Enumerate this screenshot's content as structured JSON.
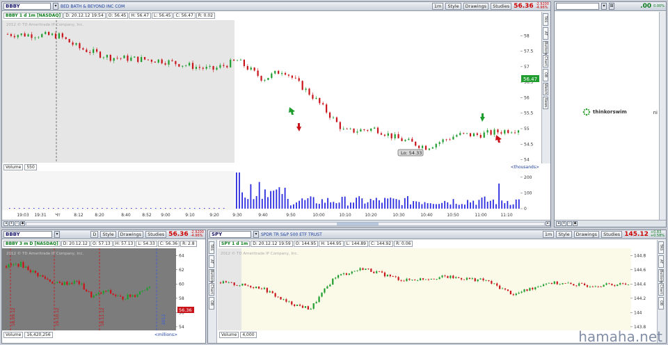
{
  "main": {
    "symbol": "BBBY",
    "description": "BED BATH & BEYOND INC COM",
    "period_label": "1m",
    "style_label": "Style",
    "drawings_label": "Drawings",
    "studies_label": "Studies",
    "price": "56.36",
    "change": "-2.9200",
    "change_pct": "-4.96%",
    "info": {
      "name": "BBBY 1 d 1m [NASDAQ]",
      "date": "D: 20.12.12 19:54",
      "open": "O: 56.45",
      "high": "H: 56.47",
      "low": "L: 56.45",
      "close": "C: 56.47",
      "range": "R: 0.02"
    },
    "copyright": "2012 © TD Ameritrade IP Company, Inc.",
    "last_price_label": "56.47",
    "lo_label": "Lo: 54.33",
    "volume_label": "Volume",
    "volume_value": "550",
    "thousands": "<thousands>",
    "time_labels": [
      "19:03",
      "19:31",
      "Чт",
      "8:12",
      "8:20",
      "8:40",
      "8:52",
      "9:00",
      "9:10",
      "9:20",
      "9:30",
      "9:40",
      "9:50",
      "10:00",
      "10:10",
      "10:20",
      "10:30",
      "10:40",
      "10:50",
      "11:00",
      "11:10"
    ]
  },
  "side_tabs": [
    "TAS",
    "AT",
    "Buttons",
    "Chart",
    "OB",
    "Watch",
    "News"
  ],
  "right_panel": {
    "value": ".00",
    "pct": "0.00%",
    "brand": "thinkorswim",
    "brand_tail": "ni"
  },
  "bottom_left": {
    "symbol": "BBBY",
    "period_label": "D",
    "style_label": "Style",
    "drawings_label": "Drawings",
    "studies_label": "Studies",
    "price": "56.36",
    "change": "-2.9200",
    "change_pct": "-4.96%",
    "info": {
      "name": "BBBY 3 m D [NASDAQ]",
      "date": "D: 20.12.12",
      "open": "O: 57.13",
      "high": "H: 57.13",
      "low": "L: 54.33",
      "close": "C: 56.36",
      "range": "R: 2.8"
    },
    "copyright": "2012 © TD Ameritrade IP Company, Inc.",
    "last_price_label": "56.36",
    "volume_label": "Volume",
    "volume_value": "16,420,256",
    "millions": "<millions>",
    "vert_labels": [
      "18.09.12",
      "19.10.12",
      "18.11.12"
    ],
    "year_label": "2012",
    "axis": [
      "64",
      "62",
      "60",
      "58",
      "56",
      "54"
    ]
  },
  "bottom_right": {
    "symbol": "SPY",
    "description": "SPDR TR S&P 500 ETF TRUST",
    "period_label": "1m",
    "style_label": "Style",
    "drawings_label": "Drawings",
    "studies_label": "Studies",
    "price": "145.12",
    "change": "+0.83",
    "change_pct": "+0.58%",
    "info": {
      "name": "SPY 1 d 1m",
      "date": "D: 20.12.12 19:59",
      "open": "O: 144.95",
      "high": "H: 144.95",
      "low": "L: 144.89",
      "close": "C: 144.92",
      "range": "R: 0.06"
    },
    "copyright": "2012 © TD Ameritrade IP Company, Inc.",
    "volume_label": "Volume",
    "volume_value": "4,000",
    "axis": [
      "144.8",
      "144.6",
      "144.4",
      "144.2",
      "144",
      "143.8"
    ]
  },
  "watermark": "hamaha.net",
  "colors": {
    "up": "#1f9d2e",
    "down": "#c8141a",
    "volume": "#2a2adf",
    "premarket": "#e6e6e6",
    "daybg": "#fbf9e8",
    "greyplot": "#7c7c7c"
  }
}
